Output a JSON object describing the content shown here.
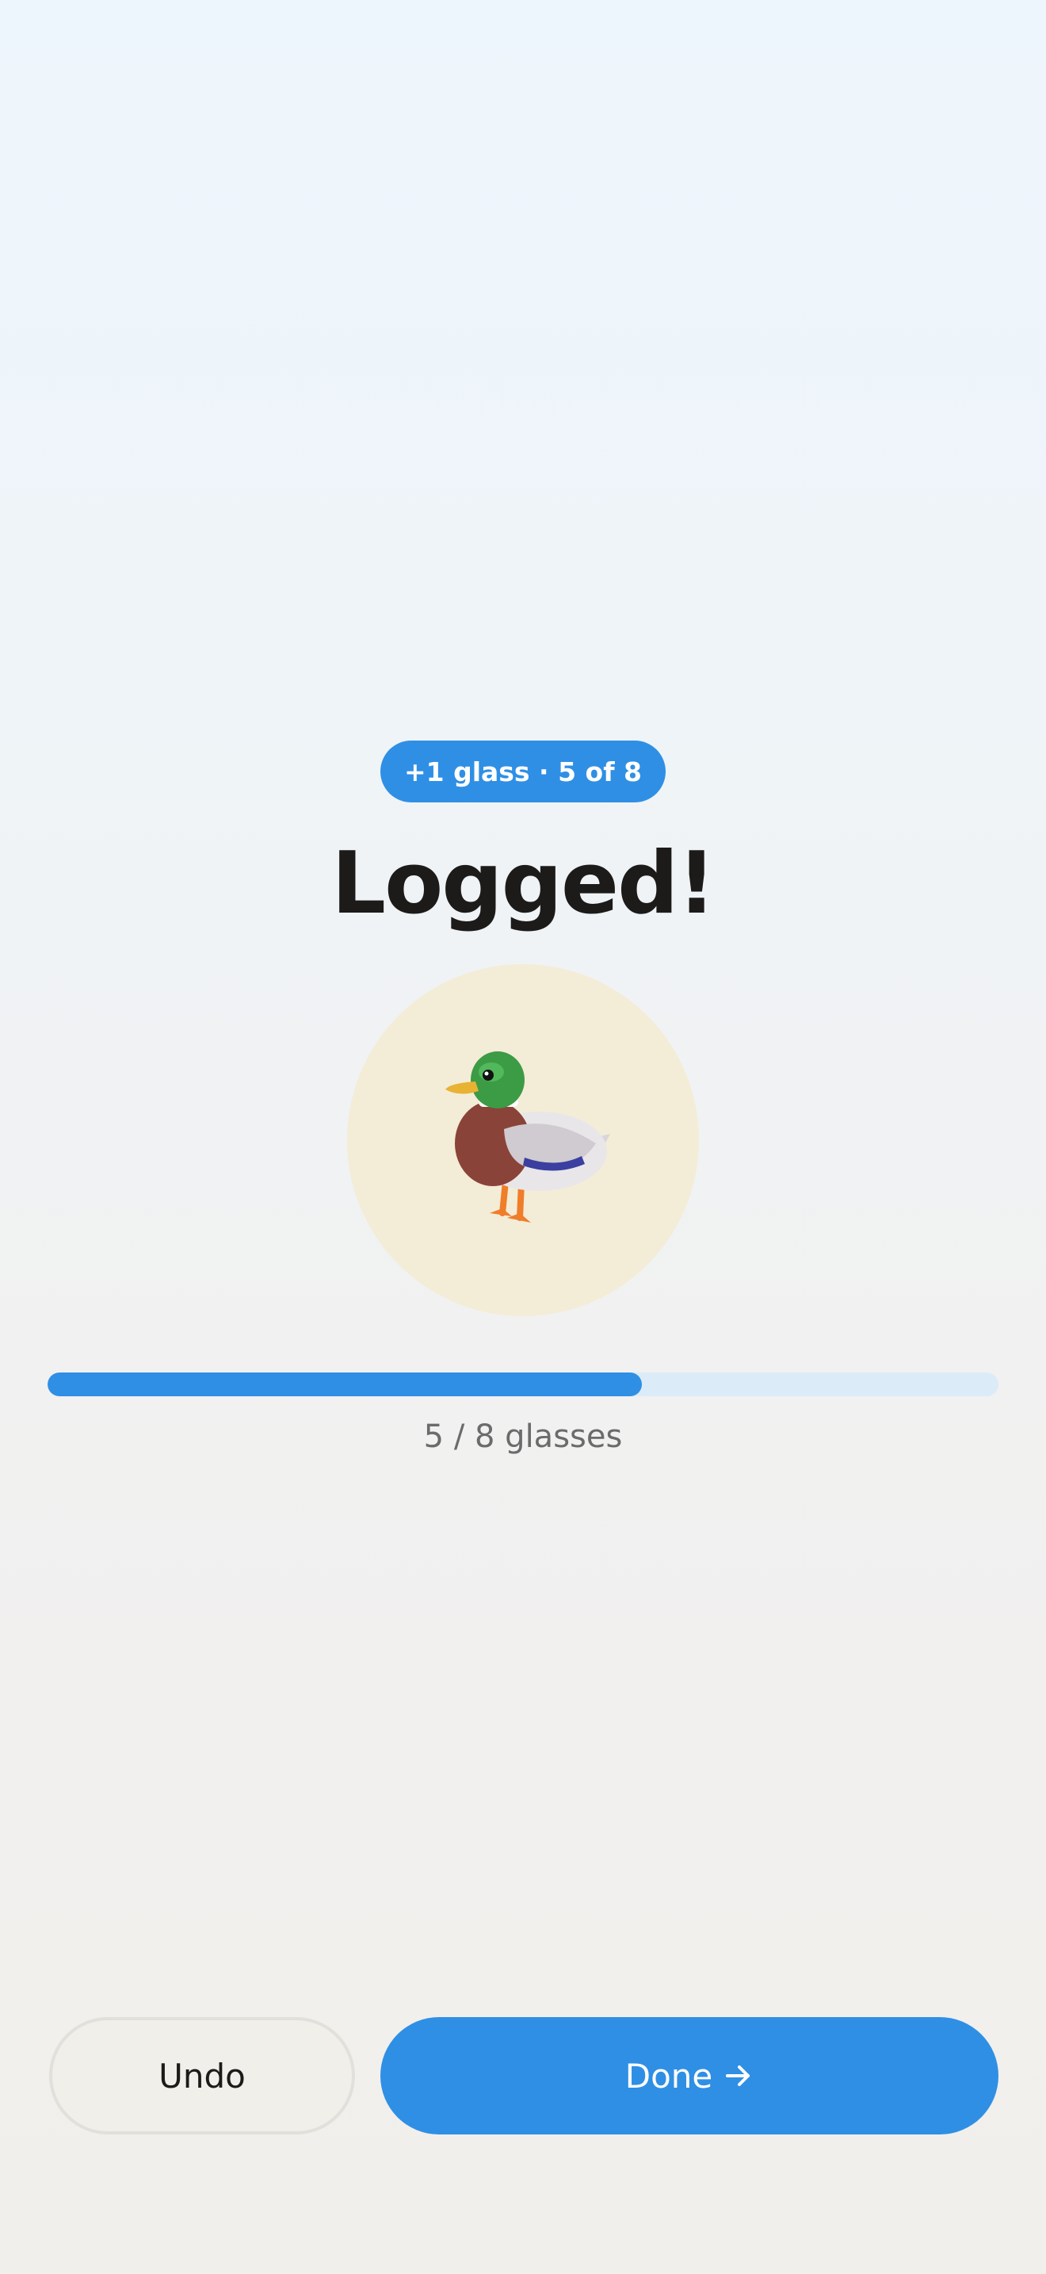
{
  "badge": {
    "text": "+1 glass · 5 of 8"
  },
  "title": "Logged!",
  "mascot": {
    "icon": "duck-icon"
  },
  "progress": {
    "current": 5,
    "goal": 8,
    "fraction": 0.625,
    "label": "5 / 8 glasses"
  },
  "actions": {
    "undo_label": "Undo",
    "done_label": "Done",
    "done_icon": "arrow-right-icon"
  },
  "colors": {
    "accent": "#2f8fe5",
    "track": "#dcebf8",
    "mascot_bg": "#f3ecd7",
    "title": "#1c1b19"
  }
}
